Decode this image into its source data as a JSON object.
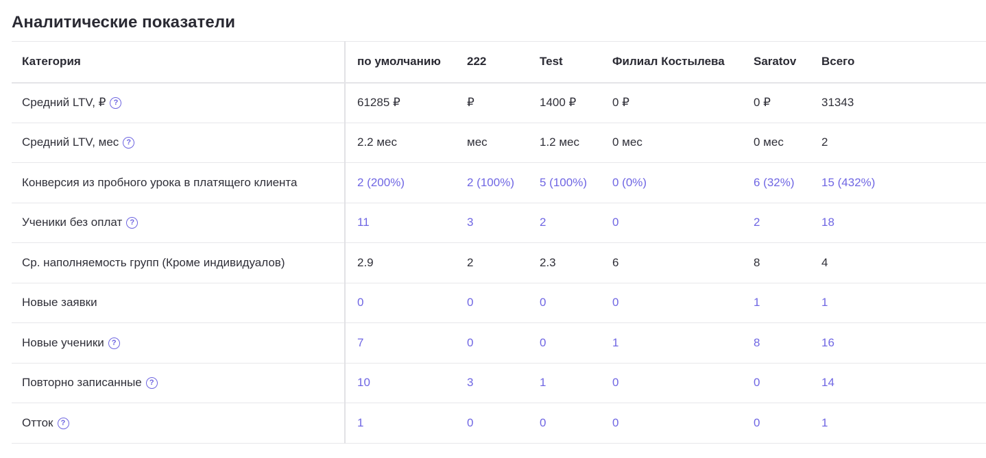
{
  "page": {
    "title": "Аналитические показатели"
  },
  "table": {
    "headers": [
      "Категория",
      "по умолчанию",
      "222",
      "Test",
      "Филиал Костылева",
      "Saratov",
      "Всего"
    ],
    "rows": [
      {
        "label": "Средний LTV, ₽",
        "help": true,
        "link": false,
        "values": [
          "61285 ₽",
          "₽",
          "1400 ₽",
          "0 ₽",
          "0 ₽",
          "31343"
        ]
      },
      {
        "label": "Средний LTV, мес",
        "help": true,
        "link": false,
        "values": [
          "2.2 мес",
          "мес",
          "1.2 мес",
          "0 мес",
          "0 мес",
          "2"
        ]
      },
      {
        "label": "Конверсия из пробного урока в платящего клиента",
        "help": false,
        "link": true,
        "values": [
          "2 (200%)",
          "2 (100%)",
          "5 (100%)",
          "0 (0%)",
          "6 (32%)",
          "15 (432%)"
        ]
      },
      {
        "label": "Ученики без оплат",
        "help": true,
        "link": true,
        "values": [
          "11",
          "3",
          "2",
          "0",
          "2",
          "18"
        ]
      },
      {
        "label": "Ср. наполняемость групп (Кроме индивидуалов)",
        "help": false,
        "link": false,
        "values": [
          "2.9",
          "2",
          "2.3",
          "6",
          "8",
          "4"
        ]
      },
      {
        "label": "Новые заявки",
        "help": false,
        "link": true,
        "values": [
          "0",
          "0",
          "0",
          "0",
          "1",
          "1"
        ]
      },
      {
        "label": "Новые ученики",
        "help": true,
        "link": true,
        "values": [
          "7",
          "0",
          "0",
          "1",
          "8",
          "16"
        ]
      },
      {
        "label": "Повторно записанные",
        "help": true,
        "link": true,
        "values": [
          "10",
          "3",
          "1",
          "0",
          "0",
          "14"
        ]
      },
      {
        "label": "Отток",
        "help": true,
        "link": true,
        "values": [
          "1",
          "0",
          "0",
          "0",
          "0",
          "1"
        ]
      }
    ]
  },
  "help_icon": {
    "icon": "question-circle-icon",
    "glyph": "?"
  },
  "colors": {
    "link": "#6f66e3",
    "text": "#2f2f38",
    "border": "#e7e7ea"
  }
}
